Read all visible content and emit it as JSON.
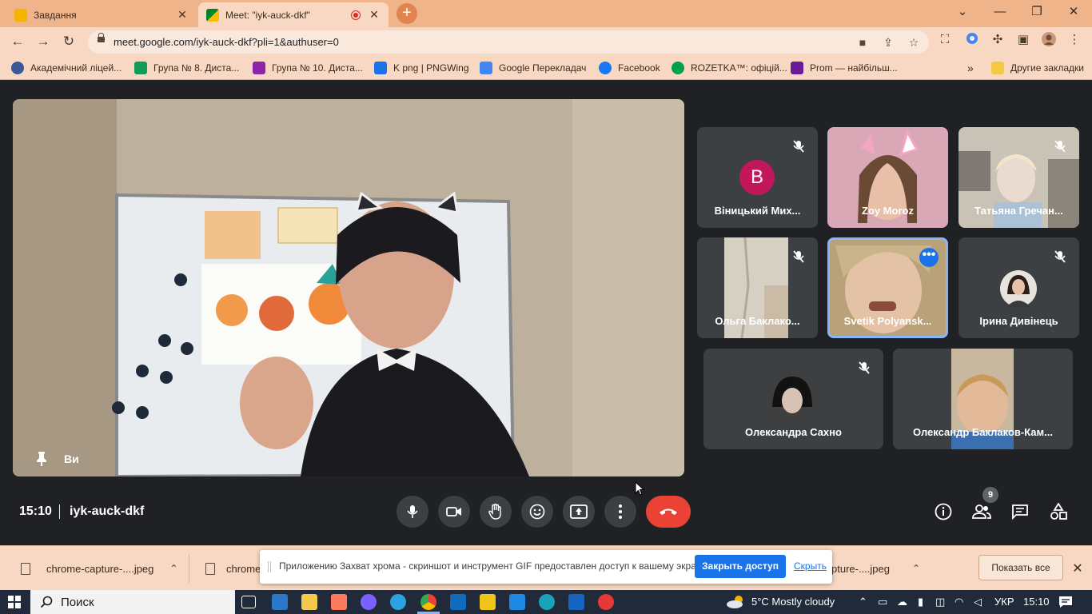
{
  "browser": {
    "tabs": [
      {
        "title": "Завдання",
        "active": false,
        "favicon_color": "#f4b400"
      },
      {
        "title": "Meet: \"iyk-auck-dkf\"",
        "active": true,
        "favicon_color": "#00832d"
      }
    ],
    "new_tab_label": "+",
    "url": "meet.google.com/iyk-auck-dkf?pli=1&authuser=0",
    "bookmarks": [
      {
        "label": "Академічний ліцей...",
        "icon_color": "#3b5998"
      },
      {
        "label": "Група № 8. Диста...",
        "icon_color": "#0f9d58"
      },
      {
        "label": "Група № 10. Диста...",
        "icon_color": "#8e24aa"
      },
      {
        "label": "K png | PNGWing",
        "icon_color": "#1a73e8"
      },
      {
        "label": "Google Перекладач",
        "icon_color": "#4285f4"
      },
      {
        "label": "Facebook",
        "icon_color": "#1877f2"
      },
      {
        "label": "ROZETKA™: офіцій...",
        "icon_color": "#00a046"
      },
      {
        "label": "Prom — найбільш...",
        "icon_color": "#6a1b9a"
      }
    ],
    "other_bookmarks": "Другие закладки",
    "overflow": "»"
  },
  "meet": {
    "main_participant": "Ви",
    "time": "15:10",
    "meeting_code": "iyk-auck-dkf",
    "participant_count": "9",
    "tiles": [
      {
        "name": "Віницький Мих...",
        "avatar_letter": "B",
        "muted": true,
        "speaking": false
      },
      {
        "name": "Zoy Moroz",
        "muted": false,
        "speaking": false
      },
      {
        "name": "Татьяна Гречан...",
        "muted": true,
        "speaking": false
      },
      {
        "name": "Ольга Баклако...",
        "muted": true,
        "speaking": false
      },
      {
        "name": "Svetik Polyansk...",
        "muted": false,
        "speaking": true
      },
      {
        "name": "Ірина Дивінець",
        "muted": true,
        "speaking": false
      },
      {
        "name": "Олександра Сахно",
        "muted": true,
        "speaking": false
      },
      {
        "name": "Олександр Баклаков-Кам...",
        "muted": false,
        "speaking": false
      }
    ]
  },
  "downloads": {
    "items": [
      "chrome-capture-....jpeg",
      "chrome",
      "pture-....jpeg"
    ],
    "show_all": "Показать все"
  },
  "share_notice": {
    "message": "Приложению Захват хрома - скриншот и инструмент GIF предоставлен доступ к вашему экрану.",
    "stop_button": "Закрыть доступ",
    "hide_link": "Скрыть"
  },
  "taskbar": {
    "search_placeholder": "Поиск",
    "weather": "5°C  Mostly cloudy",
    "language": "УКР",
    "clock": "15:10"
  },
  "colors": {
    "hangup": "#ea4335",
    "accent_blue": "#1a73e8",
    "tab_bar": "#efb48a"
  }
}
